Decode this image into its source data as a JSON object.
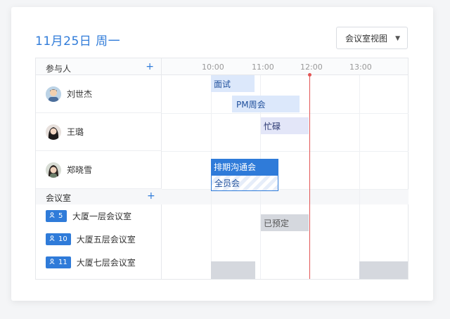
{
  "header": {
    "date": "11月25日",
    "weekday": "周一"
  },
  "view_select": {
    "value": "会议室视图"
  },
  "participants": {
    "label": "参与人",
    "people": [
      {
        "name": "刘世杰"
      },
      {
        "name": "王璐"
      },
      {
        "name": "郑晓雪"
      }
    ]
  },
  "rooms": {
    "label": "会议室",
    "items": [
      {
        "capacity": "5",
        "name": "大厦一层会议室"
      },
      {
        "capacity": "10",
        "name": "大厦五层会议室"
      },
      {
        "capacity": "11",
        "name": "大厦七层会议室"
      }
    ]
  },
  "timeline": {
    "ticks": [
      "10:00",
      "11:00",
      "12:00",
      "13:00"
    ]
  },
  "events": {
    "interview": "面试",
    "pm_weekly": "PM周会",
    "busy": "忙碌",
    "schedule_sync": "排期沟通会",
    "all_hands": "全员会",
    "booked": "已预定"
  },
  "colors": {
    "accent": "#2f7bd9",
    "now_line": "#e25555"
  }
}
